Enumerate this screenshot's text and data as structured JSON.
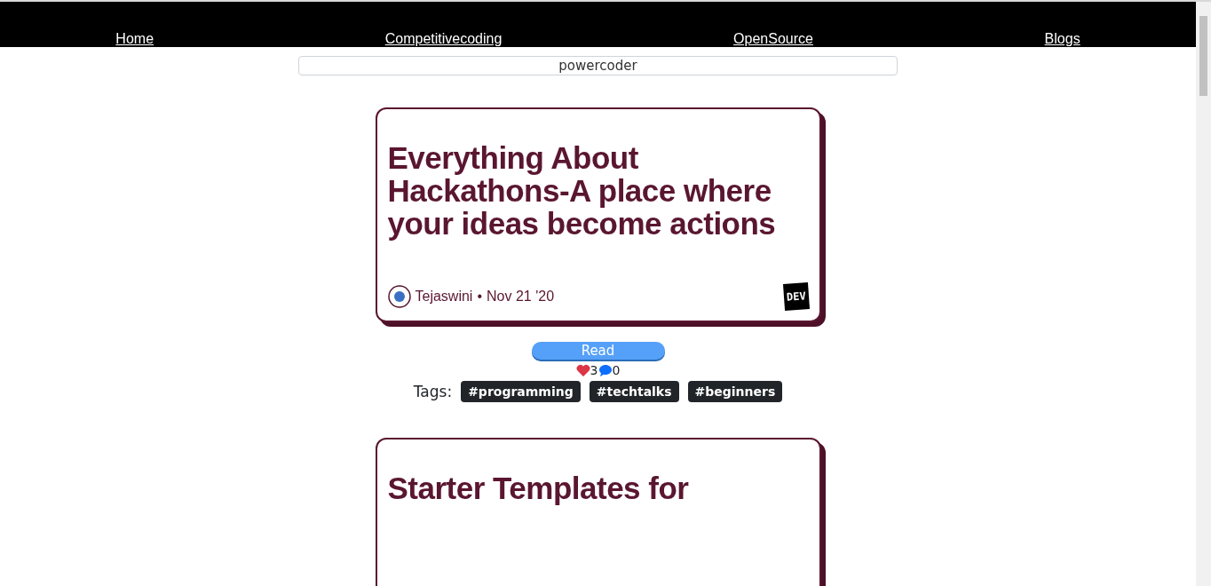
{
  "nav": {
    "links": [
      {
        "label": "Home"
      },
      {
        "label": "Competitivecoding"
      },
      {
        "label": "OpenSource"
      },
      {
        "label": "Blogs"
      }
    ]
  },
  "search": {
    "value": "powercoder"
  },
  "posts": [
    {
      "title": "Everything About Hackathons-A place where your ideas become actions",
      "author": "Tejaswini",
      "separator": "•",
      "date": "Nov 21 '20",
      "badge": "DEV",
      "button": "Read",
      "likes": "3",
      "comments": "0",
      "tags_label": "Tags:",
      "tags": [
        "#programming",
        "#techtalks",
        "#beginners"
      ]
    },
    {
      "title": "Starter Templates for"
    }
  ]
}
